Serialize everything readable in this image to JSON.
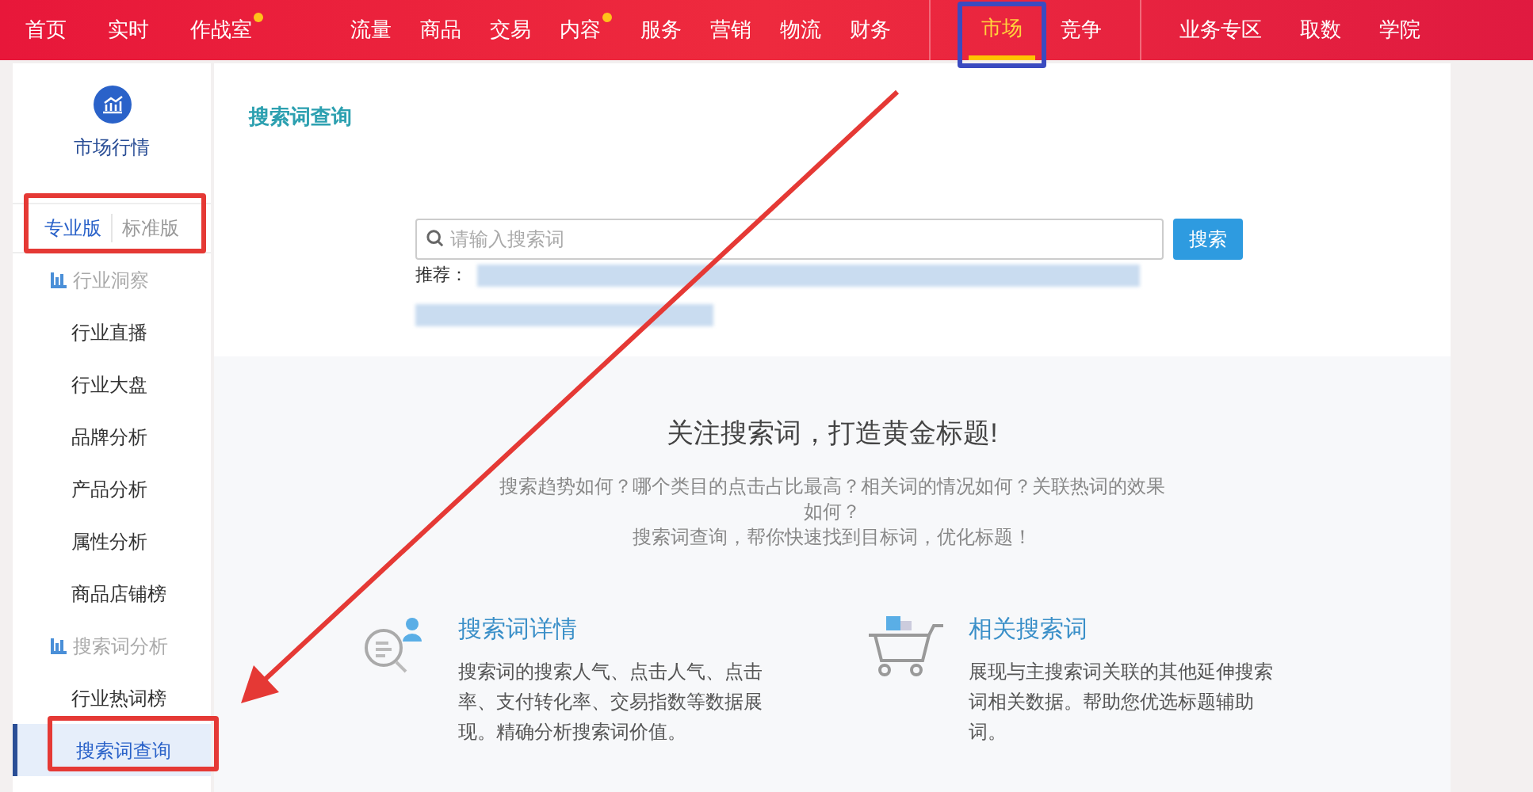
{
  "top_nav": {
    "groups": [
      [
        {
          "label": "首页",
          "dot": false,
          "selected": false
        },
        {
          "label": "实时",
          "dot": false,
          "selected": false
        },
        {
          "label": "作战室",
          "dot": true,
          "selected": false
        }
      ],
      [
        {
          "label": "流量",
          "dot": false,
          "selected": false
        },
        {
          "label": "商品",
          "dot": false,
          "selected": false
        },
        {
          "label": "交易",
          "dot": false,
          "selected": false
        },
        {
          "label": "内容",
          "dot": true,
          "selected": false
        },
        {
          "label": "服务",
          "dot": false,
          "selected": false
        },
        {
          "label": "营销",
          "dot": false,
          "selected": false
        },
        {
          "label": "物流",
          "dot": false,
          "selected": false
        },
        {
          "label": "财务",
          "dot": false,
          "selected": false
        }
      ],
      [
        {
          "label": "市场",
          "dot": false,
          "selected": true
        },
        {
          "label": "竞争",
          "dot": false,
          "selected": false
        }
      ],
      [
        {
          "label": "业务专区",
          "dot": false,
          "selected": false
        },
        {
          "label": "取数",
          "dot": false,
          "selected": false
        },
        {
          "label": "学院",
          "dot": false,
          "selected": false
        }
      ]
    ]
  },
  "sidebar": {
    "title": "市场行情",
    "tabs": [
      {
        "label": "专业版",
        "selected": true
      },
      {
        "label": "标准版",
        "selected": false
      }
    ],
    "groups": [
      {
        "label": "行业洞察",
        "items": [
          {
            "label": "行业直播",
            "selected": false
          },
          {
            "label": "行业大盘",
            "selected": false
          },
          {
            "label": "品牌分析",
            "selected": false
          },
          {
            "label": "产品分析",
            "selected": false
          },
          {
            "label": "属性分析",
            "selected": false
          },
          {
            "label": "商品店铺榜",
            "selected": false
          }
        ]
      },
      {
        "label": "搜索词分析",
        "items": [
          {
            "label": "行业热词榜",
            "selected": false
          },
          {
            "label": "搜索词查询",
            "selected": true
          }
        ]
      }
    ]
  },
  "main": {
    "title": "搜索词查询",
    "search": {
      "placeholder": "请输入搜索词",
      "button": "搜索"
    },
    "recommend_label": "推荐：",
    "headline": "关注搜索词，打造黄金标题!",
    "intro": [
      "搜索趋势如何？哪个类目的点击占比最高？相关词的情况如何？关联热词的效果如何？",
      "搜索词查询，帮你快速找到目标词，优化标题！"
    ],
    "features": [
      {
        "kind": "search",
        "title": "搜索词详情",
        "text": "搜索词的搜索人气、点击人气、点击率、支付转化率、交易指数等数据展现。精确分析搜索词价值。"
      },
      {
        "kind": "cart",
        "title": "相关搜索词",
        "text": "展现与主搜索词关联的其他延伸搜索词相关数据。帮助您优选标题辅助词。"
      }
    ]
  },
  "annotations": [
    {
      "kind": "box",
      "color": "#e53935"
    },
    {
      "kind": "box",
      "color": "#e53935"
    },
    {
      "kind": "box",
      "color": "#3b4bc0"
    },
    {
      "kind": "arrow",
      "color": "#e53935"
    }
  ]
}
